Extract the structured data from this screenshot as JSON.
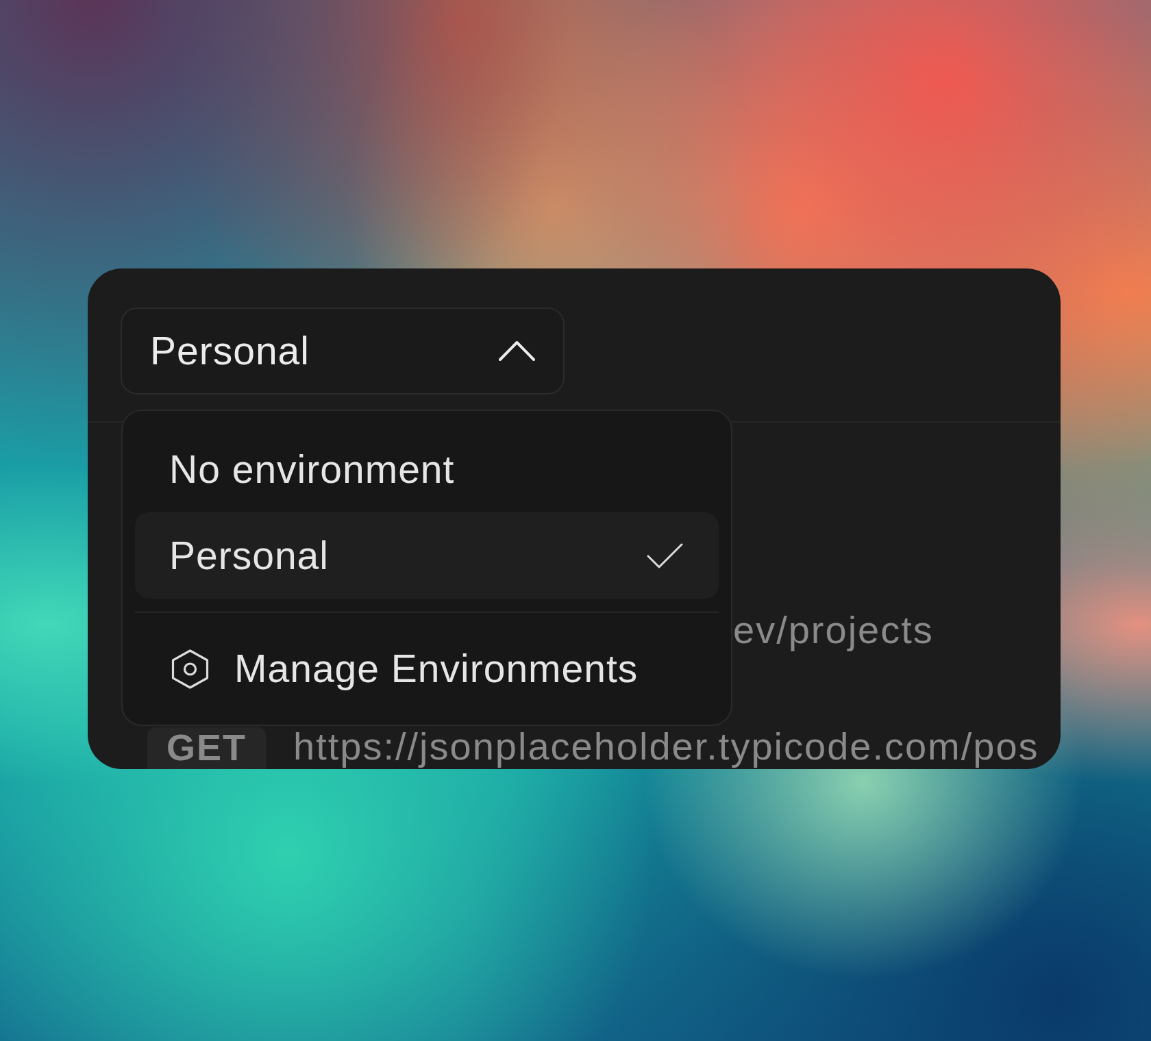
{
  "environment_selector": {
    "value": "Personal",
    "expanded": true
  },
  "environment_menu": {
    "items": [
      {
        "label": "No environment",
        "selected": false
      },
      {
        "label": "Personal",
        "selected": true
      }
    ],
    "manage_action": {
      "label": "Manage Environments"
    }
  },
  "background_content": {
    "path_text": "ev/projects",
    "request": {
      "method": "GET",
      "url": "https://jsonplaceholder.typicode.com/pos"
    }
  }
}
